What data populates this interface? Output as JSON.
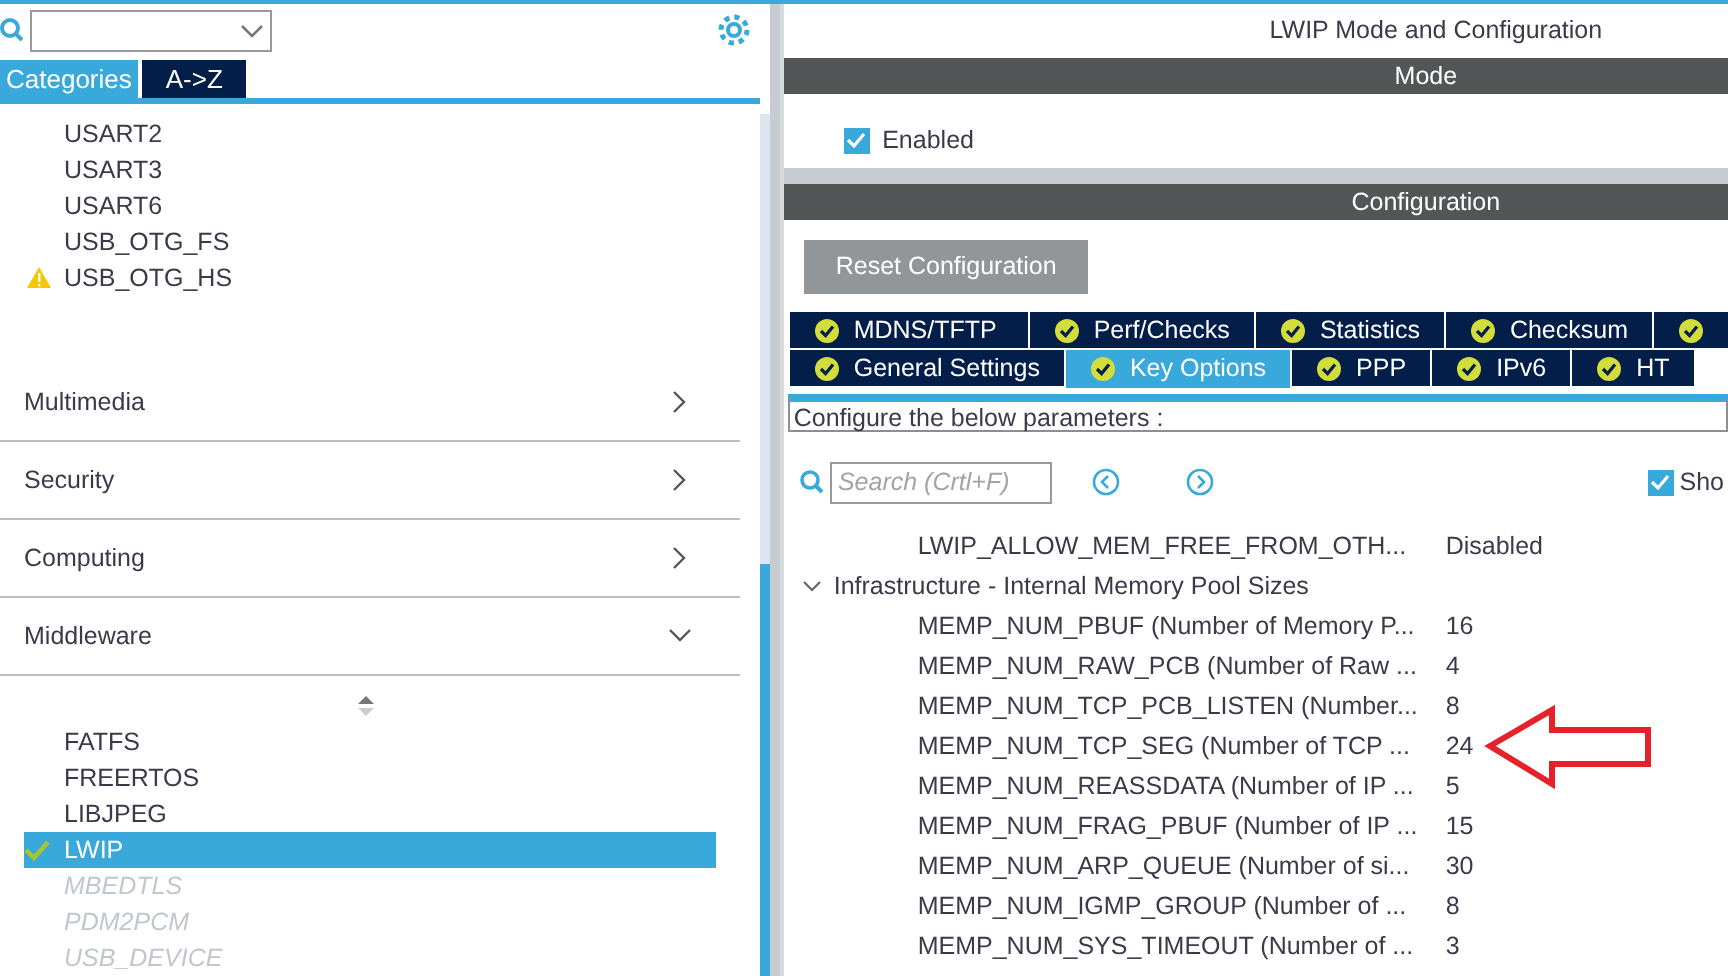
{
  "sidebar": {
    "tabs": [
      {
        "label": "Categories",
        "selected": true
      },
      {
        "label": "A->Z",
        "selected": false
      }
    ],
    "peripherals": [
      {
        "label": "USART2",
        "warning": false
      },
      {
        "label": "USART3",
        "warning": false
      },
      {
        "label": "USART6",
        "warning": false
      },
      {
        "label": "USB_OTG_FS",
        "warning": false
      },
      {
        "label": "USB_OTG_HS",
        "warning": true
      }
    ],
    "categories": [
      {
        "label": "Multimedia",
        "expanded": false
      },
      {
        "label": "Security",
        "expanded": false
      },
      {
        "label": "Computing",
        "expanded": false
      },
      {
        "label": "Middleware",
        "expanded": true
      }
    ],
    "middleware_items": [
      {
        "label": "FATFS",
        "enabled": true,
        "checked": false,
        "selected": false
      },
      {
        "label": "FREERTOS",
        "enabled": true,
        "checked": false,
        "selected": false
      },
      {
        "label": "LIBJPEG",
        "enabled": true,
        "checked": false,
        "selected": false
      },
      {
        "label": "LWIP",
        "enabled": true,
        "checked": true,
        "selected": true
      },
      {
        "label": "MBEDTLS",
        "enabled": false,
        "checked": false,
        "selected": false
      },
      {
        "label": "PDM2PCM",
        "enabled": false,
        "checked": false,
        "selected": false
      },
      {
        "label": "USB_DEVICE",
        "enabled": false,
        "checked": false,
        "selected": false
      }
    ]
  },
  "panel": {
    "title": "LWIP Mode and Configuration",
    "mode_header": "Mode",
    "enabled": {
      "label": "Enabled",
      "checked": true
    },
    "config_header": "Configuration",
    "reset_button": "Reset Configuration",
    "tab_rows": [
      [
        {
          "label": "MDNS/TFTP",
          "selected": false
        },
        {
          "label": "Perf/Checks",
          "selected": false
        },
        {
          "label": "Statistics",
          "selected": false
        },
        {
          "label": "Checksum",
          "selected": false
        },
        {
          "selected": false
        }
      ],
      [
        {
          "label": "General Settings",
          "selected": false
        },
        {
          "label": "Key Options",
          "selected": true
        },
        {
          "label": "PPP",
          "selected": false
        },
        {
          "label": "IPv6",
          "selected": false
        },
        {
          "label": "HT",
          "selected": false
        }
      ]
    ],
    "hint": "Configure the below parameters :",
    "search": {
      "placeholder": "Search (Crtl+F)"
    },
    "show_option": {
      "label": "Sho",
      "checked": true
    },
    "parameters": [
      {
        "name": "LWIP_ALLOW_MEM_FREE_FROM_OTH...",
        "value": "Disabled"
      }
    ],
    "group": {
      "label": "Infrastructure - Internal Memory Pool Sizes",
      "expanded": true,
      "children": [
        {
          "name": "MEMP_NUM_PBUF (Number of Memory P...",
          "value": "16",
          "marked": false
        },
        {
          "name": "MEMP_NUM_RAW_PCB (Number of Raw ...",
          "value": "4",
          "marked": false
        },
        {
          "name": "MEMP_NUM_TCP_PCB_LISTEN (Number...",
          "value": "8",
          "marked": false
        },
        {
          "name": "MEMP_NUM_TCP_SEG (Number of TCP ...",
          "value": "24",
          "marked": true
        },
        {
          "name": "MEMP_NUM_REASSDATA (Number of IP ...",
          "value": "5",
          "marked": false
        },
        {
          "name": "MEMP_NUM_FRAG_PBUF (Number of IP ...",
          "value": "15",
          "marked": false
        },
        {
          "name": "MEMP_NUM_ARP_QUEUE (Number of si...",
          "value": "30",
          "marked": false
        },
        {
          "name": "MEMP_NUM_IGMP_GROUP (Number of ...",
          "value": "8",
          "marked": false
        },
        {
          "name": "MEMP_NUM_SYS_TIMEOUT (Number of ...",
          "value": "3",
          "marked": false
        }
      ]
    }
  }
}
